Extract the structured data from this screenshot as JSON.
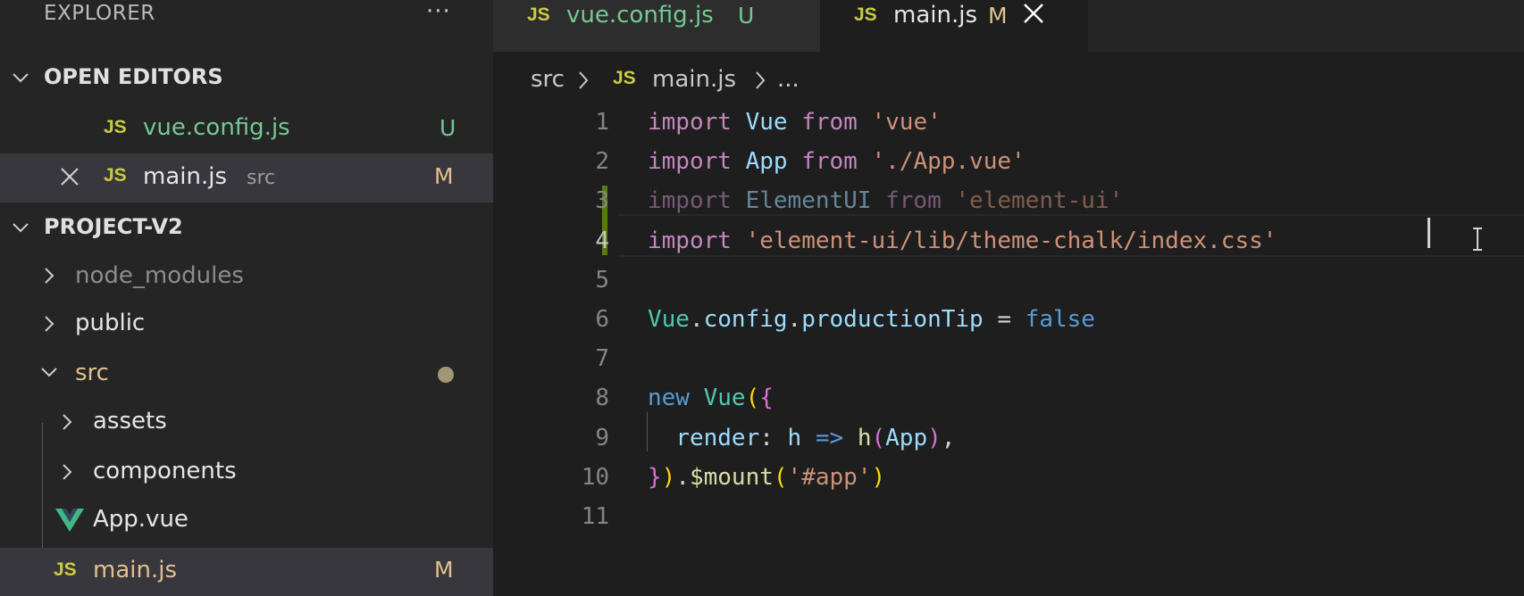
{
  "sidebar": {
    "title": "EXPLORER",
    "more_actions": "···",
    "open_editors": {
      "title": "OPEN EDITORS",
      "items": [
        {
          "icon": "JS",
          "name": "vue.config.js",
          "status": "U"
        },
        {
          "icon": "JS",
          "name": "main.js",
          "description": "src",
          "status": "M"
        }
      ]
    },
    "project": {
      "title": "PROJECT-V2",
      "items": [
        {
          "name": "node_modules"
        },
        {
          "name": "public"
        },
        {
          "name": "src"
        },
        {
          "name": "assets"
        },
        {
          "name": "components"
        },
        {
          "name": "App.vue"
        },
        {
          "icon": "JS",
          "name": "main.js",
          "status": "M"
        }
      ]
    }
  },
  "tabs": [
    {
      "icon": "JS",
      "label": "vue.config.js",
      "status": "U"
    },
    {
      "icon": "JS",
      "label": "main.js",
      "status": "M"
    }
  ],
  "breadcrumb": {
    "folder": "src",
    "icon": "JS",
    "file": "main.js",
    "more": "..."
  },
  "editor": {
    "line_numbers": [
      "1",
      "2",
      "3",
      "4",
      "5",
      "6",
      "7",
      "8",
      "9",
      "10",
      "11"
    ],
    "current_line": "4",
    "lines": [
      [
        {
          "t": "import",
          "c": "kw"
        },
        {
          "t": " ",
          "c": "op"
        },
        {
          "t": "Vue",
          "c": "id"
        },
        {
          "t": " ",
          "c": "op"
        },
        {
          "t": "from",
          "c": "kw"
        },
        {
          "t": " ",
          "c": "op"
        },
        {
          "t": "'vue'",
          "c": "st"
        }
      ],
      [
        {
          "t": "import",
          "c": "kw"
        },
        {
          "t": " ",
          "c": "op"
        },
        {
          "t": "App",
          "c": "id"
        },
        {
          "t": " ",
          "c": "op"
        },
        {
          "t": "from",
          "c": "kw"
        },
        {
          "t": " ",
          "c": "op"
        },
        {
          "t": "'./App.vue'",
          "c": "st"
        }
      ],
      [
        {
          "t": "import",
          "c": "kw dim"
        },
        {
          "t": " ",
          "c": "op"
        },
        {
          "t": "ElementUI",
          "c": "id dim"
        },
        {
          "t": " ",
          "c": "op"
        },
        {
          "t": "from",
          "c": "kw dim"
        },
        {
          "t": " ",
          "c": "op"
        },
        {
          "t": "'element-ui'",
          "c": "st dim"
        }
      ],
      [
        {
          "t": "import",
          "c": "kw"
        },
        {
          "t": " ",
          "c": "op"
        },
        {
          "t": "'element-ui/lib/theme-chalk/index.css'",
          "c": "st"
        }
      ],
      [],
      [
        {
          "t": "Vue",
          "c": "cls"
        },
        {
          "t": ".",
          "c": "op"
        },
        {
          "t": "config",
          "c": "id"
        },
        {
          "t": ".",
          "c": "op"
        },
        {
          "t": "productionTip",
          "c": "id"
        },
        {
          "t": " = ",
          "c": "op"
        },
        {
          "t": "false",
          "c": "bl"
        }
      ],
      [],
      [
        {
          "t": "new",
          "c": "bl"
        },
        {
          "t": " ",
          "c": "op"
        },
        {
          "t": "Vue",
          "c": "cls"
        },
        {
          "t": "(",
          "c": "br2"
        },
        {
          "t": "{",
          "c": "br1"
        }
      ],
      [
        {
          "t": "  ",
          "c": "op"
        },
        {
          "t": "render",
          "c": "id"
        },
        {
          "t": ": ",
          "c": "op"
        },
        {
          "t": "h",
          "c": "id"
        },
        {
          "t": " ",
          "c": "op"
        },
        {
          "t": "=>",
          "c": "bl"
        },
        {
          "t": " ",
          "c": "op"
        },
        {
          "t": "h",
          "c": "fn"
        },
        {
          "t": "(",
          "c": "br1"
        },
        {
          "t": "App",
          "c": "id"
        },
        {
          "t": ")",
          "c": "br1"
        },
        {
          "t": ",",
          "c": "op"
        }
      ],
      [
        {
          "t": "}",
          "c": "br1"
        },
        {
          "t": ")",
          "c": "br2"
        },
        {
          "t": ".",
          "c": "op"
        },
        {
          "t": "$mount",
          "c": "fn"
        },
        {
          "t": "(",
          "c": "br2"
        },
        {
          "t": "'#app'",
          "c": "st"
        },
        {
          "t": ")",
          "c": "br2"
        }
      ],
      []
    ]
  },
  "colors": {
    "git_added": "#587c0c",
    "untracked": "#73c991",
    "modified": "#e2c08d",
    "js_icon": "#cbcb41",
    "vue_icon": "#41b883"
  }
}
